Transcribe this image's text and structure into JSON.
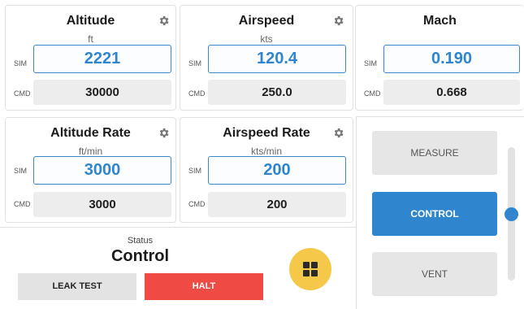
{
  "cards": {
    "altitude": {
      "title": "Altitude",
      "unit": "ft",
      "sim": "2221",
      "cmd": "30000"
    },
    "airspeed": {
      "title": "Airspeed",
      "unit": "kts",
      "sim": "120.4",
      "cmd": "250.0"
    },
    "mach": {
      "title": "Mach",
      "unit": "",
      "sim": "0.190",
      "cmd": "0.668"
    },
    "altitude_rate": {
      "title": "Altitude Rate",
      "unit": "ft/min",
      "sim": "3000",
      "cmd": "3000"
    },
    "airspeed_rate": {
      "title": "Airspeed Rate",
      "unit": "kts/min",
      "sim": "200",
      "cmd": "200"
    }
  },
  "labels": {
    "sim": "SIM",
    "cmd": "CMD"
  },
  "status": {
    "label": "Status",
    "value": "Control"
  },
  "buttons": {
    "leak_test": "LEAK TEST",
    "halt": "HALT"
  },
  "modes": {
    "measure": "MEASURE",
    "control": "CONTROL",
    "vent": "VENT",
    "selected": "CONTROL"
  },
  "slider": {
    "level": 0.5
  },
  "icons": {
    "settings": "gear-icon",
    "grid": "grid-icon"
  },
  "colors": {
    "accent": "#2f86cf",
    "halt": "#ef4a43",
    "round_button": "#f5c84a",
    "neutral": "#e6e6e6"
  }
}
